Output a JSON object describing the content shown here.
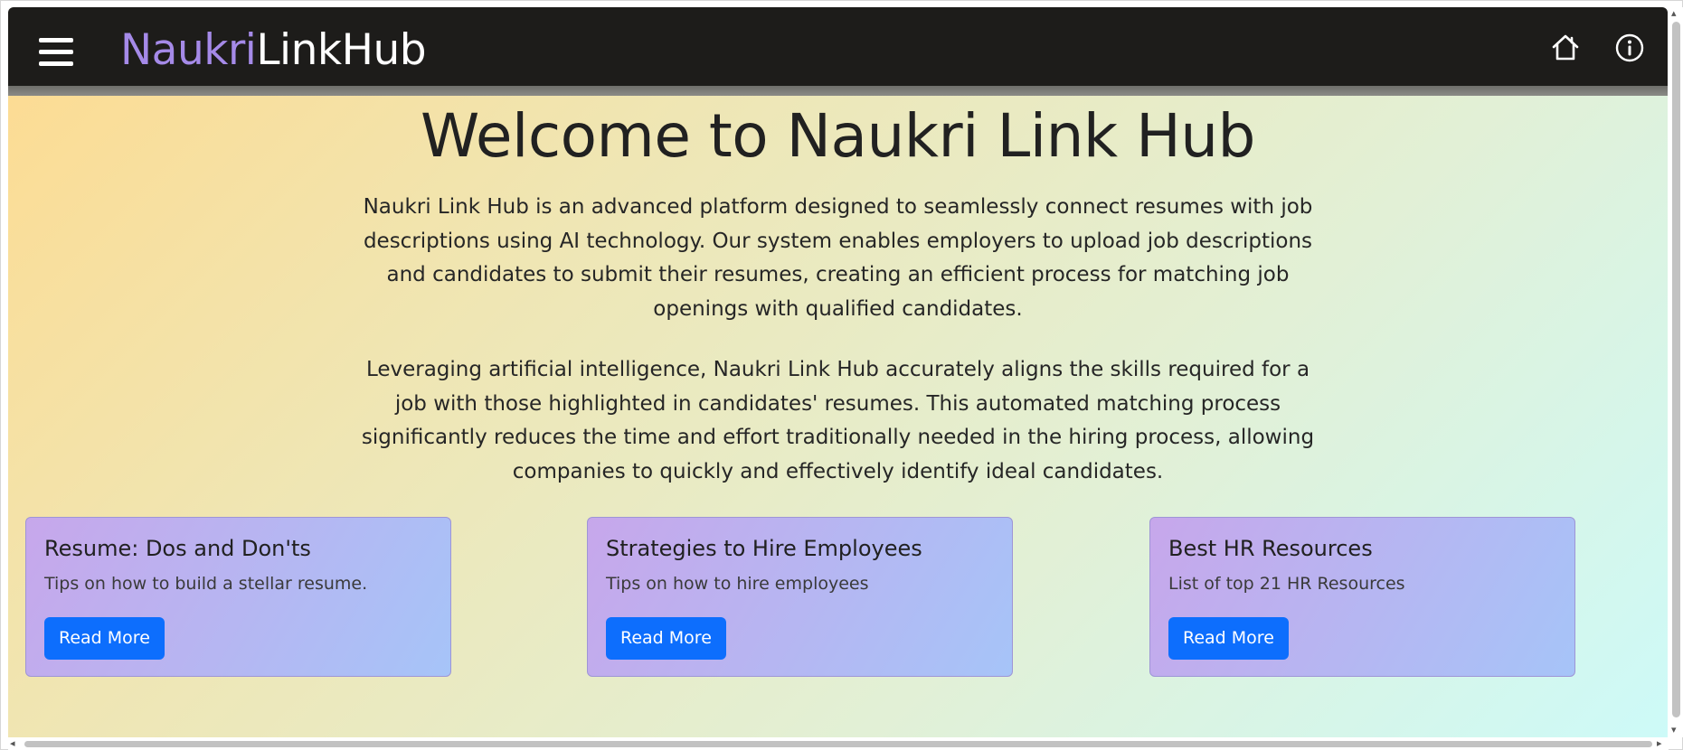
{
  "navbar": {
    "menu_icon": "hamburger-menu-icon",
    "brand_part1": "Naukri",
    "brand_part2": "LinkHub",
    "home_icon": "home-icon",
    "info_icon": "info-icon",
    "brand_accent_color": "#a58ae8",
    "background_color": "#1d1c1a"
  },
  "hero": {
    "title": "Welcome to Naukri Link Hub",
    "paragraph1": "Naukri Link Hub is an advanced platform designed to seamlessly connect resumes with job descriptions using AI technology. Our system enables employers to upload job descriptions and candidates to submit their resumes, creating an efficient process for matching job openings with qualified candidates.",
    "paragraph2": "Leveraging artificial intelligence, Naukri Link Hub accurately aligns the skills required for a job with those highlighted in candidates' resumes. This automated matching process significantly reduces the time and effort traditionally needed in the hiring process, allowing companies to quickly and effectively identify ideal candidates."
  },
  "cards": [
    {
      "title": "Resume: Dos and Don'ts",
      "text": "Tips on how to build a stellar resume.",
      "button": "Read More"
    },
    {
      "title": "Strategies to Hire Employees",
      "text": "Tips on how to hire employees",
      "button": "Read More"
    },
    {
      "title": "Best HR Resources",
      "text": "List of top 21 HR Resources",
      "button": "Read More"
    }
  ],
  "colors": {
    "button_primary": "#0d6efd",
    "gradient_start": "#fcdc94",
    "gradient_end": "#cdfaf8"
  }
}
